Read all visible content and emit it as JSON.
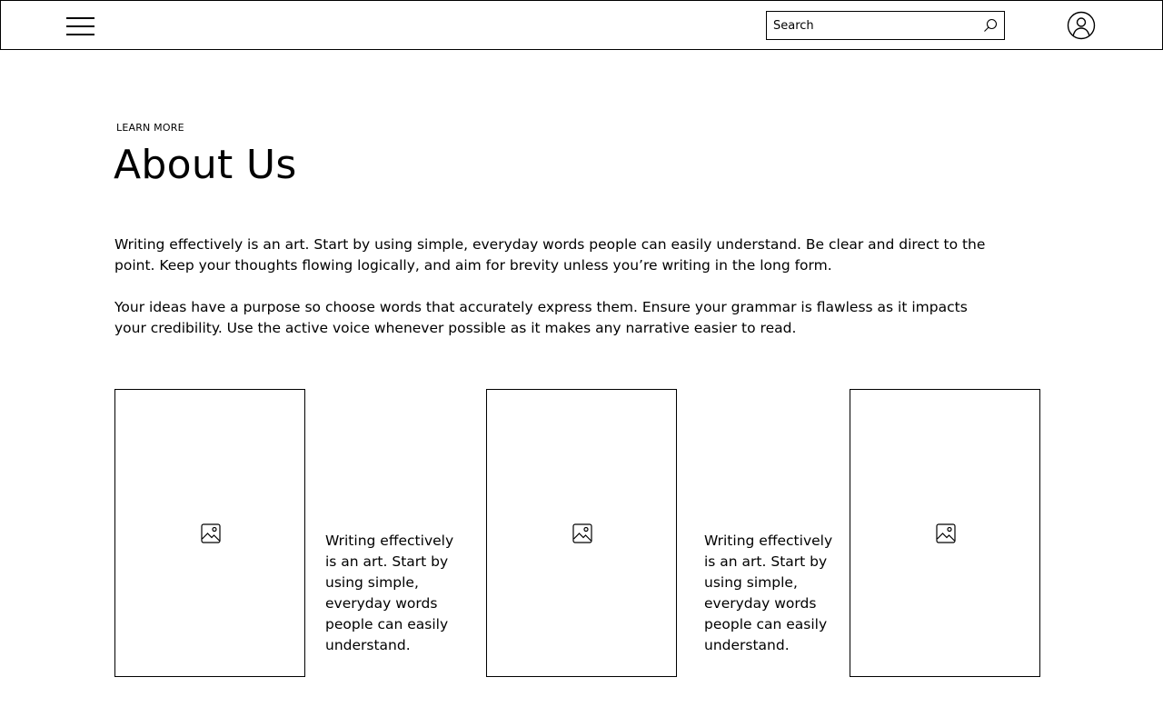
{
  "header": {
    "menu_icon": "hamburger-menu-icon",
    "search": {
      "placeholder": "Search",
      "value": "",
      "icon": "search-icon"
    },
    "profile_icon": "user-avatar-icon"
  },
  "main": {
    "eyebrow": "LEARN MORE",
    "title": "About Us",
    "paragraphs": [
      "Writing effectively is an art. Start by using simple, everyday words people can easily understand. Be clear and direct to the point. Keep your thoughts flowing logically, and aim for brevity unless you’re writing in the long form.",
      "Your ideas have a purpose so choose words that accurately express them. Ensure your grammar is flawless as it impacts your credibility. Use the active voice whenever possible as it makes any narrative easier to read."
    ],
    "gallery": {
      "image_icon": "image-placeholder-icon",
      "captions": [
        "Writing effectively is an art. Start by using simple, everyday words people can easily understand.",
        "Writing effectively is an art. Start by using simple, everyday words people can easily understand."
      ]
    }
  },
  "colors": {
    "text": "#000000",
    "background": "#ffffff",
    "border": "#000000"
  }
}
